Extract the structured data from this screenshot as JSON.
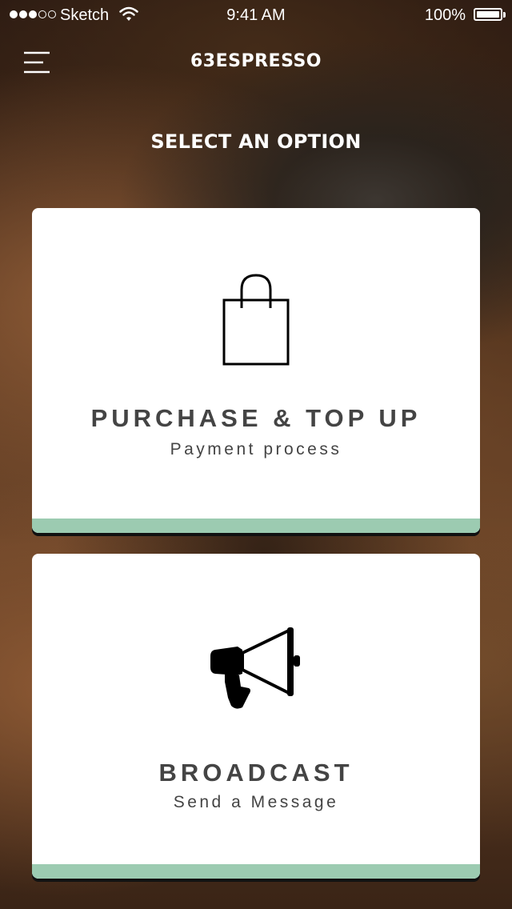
{
  "status_bar": {
    "carrier": "Sketch",
    "time": "9:41 AM",
    "battery_percent": "100%",
    "signal_bars_filled": 3,
    "signal_bars_total": 5
  },
  "nav": {
    "title": "63ESPRESSO",
    "menu_icon": "hamburger-menu-icon"
  },
  "heading": "SELECT AN OPTION",
  "options": [
    {
      "title": "PURCHASE & TOP UP",
      "subtitle": "Payment process",
      "icon": "shopping-bag-icon"
    },
    {
      "title": "BROADCAST",
      "subtitle": "Send a Message",
      "icon": "megaphone-icon"
    }
  ],
  "colors": {
    "card_stripe": "#9ccbb1",
    "card_text": "#444444"
  }
}
